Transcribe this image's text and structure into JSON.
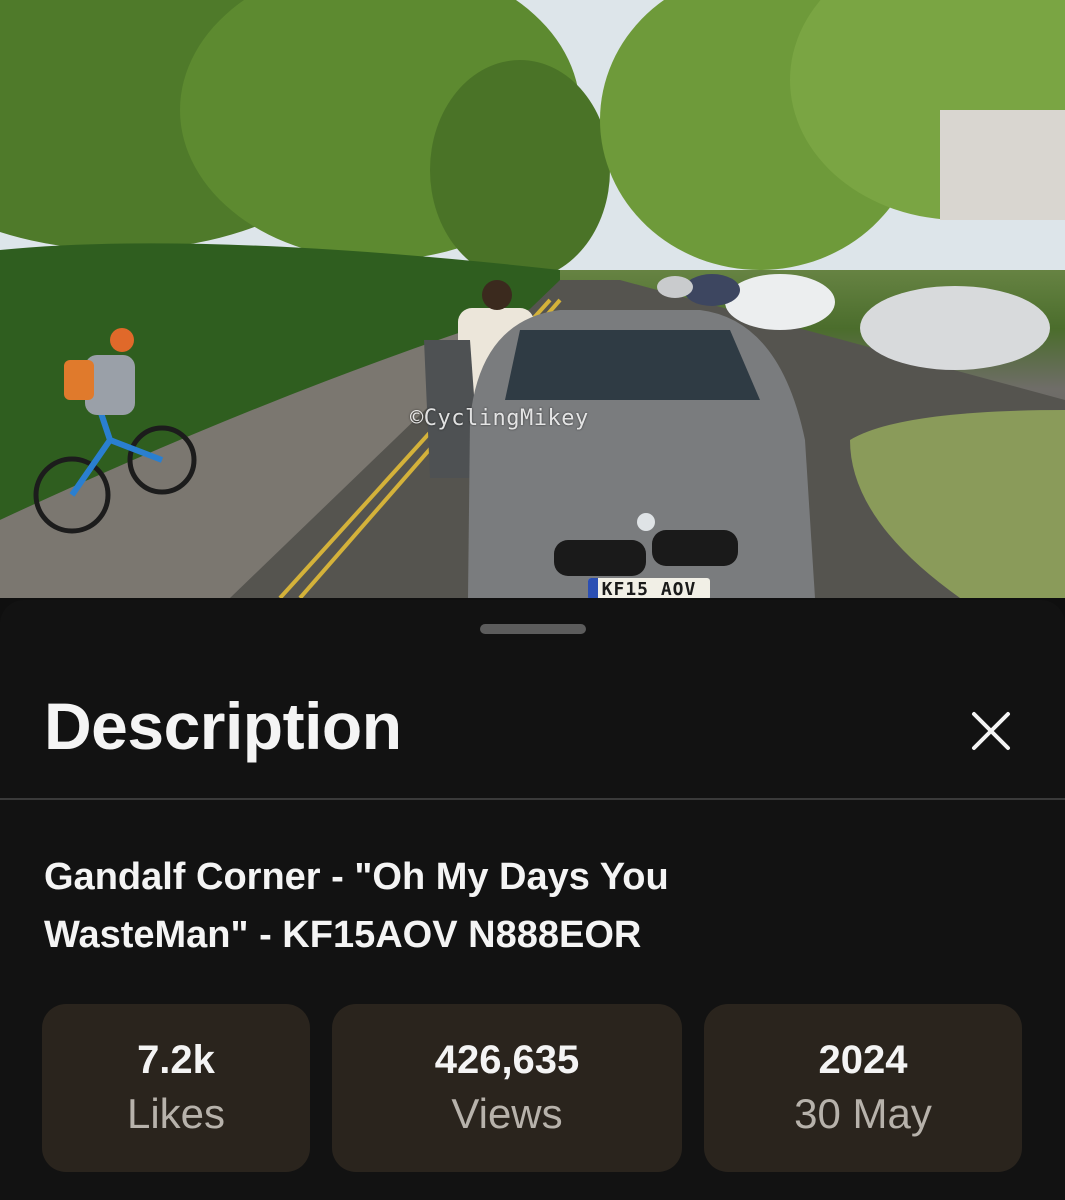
{
  "video": {
    "watermark": "©CyclingMikey",
    "plate": "KF15 AOV"
  },
  "description_panel": {
    "title": "Description",
    "close_icon": "close-icon",
    "video_title": "Gandalf Corner - \"Oh My Days You WasteMan\" - KF15AOV N888EOR",
    "stats": {
      "likes_value": "7.2k",
      "likes_label": "Likes",
      "views_value": "426,635",
      "views_label": "Views",
      "year": "2024",
      "date": "30 May"
    }
  },
  "colors": {
    "sheet_bg": "#121212",
    "stat_bg": "#2a241d",
    "text_primary": "#f4f4f4",
    "text_secondary": "#b7b2ab"
  }
}
